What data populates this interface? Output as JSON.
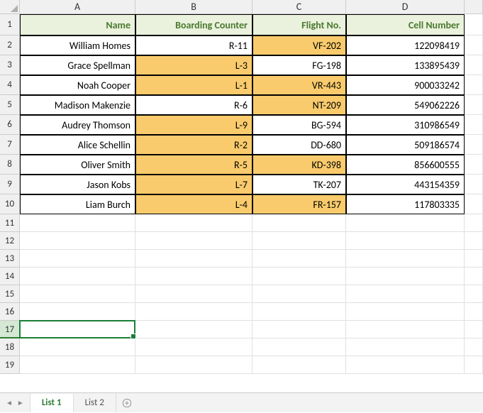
{
  "columns": [
    "A",
    "B",
    "C",
    "D",
    ""
  ],
  "row_numbers": [
    1,
    2,
    3,
    4,
    5,
    6,
    7,
    8,
    9,
    10,
    11,
    12,
    13,
    14,
    15,
    16,
    17,
    18,
    19
  ],
  "header": {
    "A": "Name",
    "B": "Boarding Counter",
    "C": "Flight No.",
    "D": "Cell Number"
  },
  "rows": [
    {
      "A": "William Homes",
      "B": "R-11",
      "C": "VF-202",
      "D": "122098419",
      "hl": {
        "B": false,
        "C": true
      }
    },
    {
      "A": "Grace Spellman",
      "B": "L-3",
      "C": "FG-198",
      "D": "133895439",
      "hl": {
        "B": true,
        "C": false
      }
    },
    {
      "A": "Noah Cooper",
      "B": "L-1",
      "C": "VR-443",
      "D": "900033242",
      "hl": {
        "B": true,
        "C": true
      }
    },
    {
      "A": "Madison Makenzie",
      "B": "R-6",
      "C": "NT-209",
      "D": "549062226",
      "hl": {
        "B": false,
        "C": true
      }
    },
    {
      "A": "Audrey Thomson",
      "B": "L-9",
      "C": "BG-594",
      "D": "310986549",
      "hl": {
        "B": true,
        "C": false
      }
    },
    {
      "A": "Alice Schellin",
      "B": "R-2",
      "C": "DD-680",
      "D": "509186574",
      "hl": {
        "B": true,
        "C": false
      }
    },
    {
      "A": "Oliver Smith",
      "B": "R-5",
      "C": "KD-398",
      "D": "856600555",
      "hl": {
        "B": true,
        "C": true
      }
    },
    {
      "A": "Jason Kobs",
      "B": "L-7",
      "C": "TK-207",
      "D": "443154359",
      "hl": {
        "B": true,
        "C": false
      }
    },
    {
      "A": "Liam Burch",
      "B": "L-4",
      "C": "FR-157",
      "D": "117803335",
      "hl": {
        "B": true,
        "C": true
      }
    }
  ],
  "active_cell_row": 17,
  "tabs": {
    "items": [
      "List 1",
      "List 2"
    ],
    "active": 0
  },
  "chart_data": {
    "type": "table",
    "columns": [
      "Name",
      "Boarding Counter",
      "Flight No.",
      "Cell Number"
    ],
    "rows": [
      [
        "William Homes",
        "R-11",
        "VF-202",
        122098419
      ],
      [
        "Grace Spellman",
        "L-3",
        "FG-198",
        133895439
      ],
      [
        "Noah Cooper",
        "L-1",
        "VR-443",
        900033242
      ],
      [
        "Madison Makenzie",
        "R-6",
        "NT-209",
        549062226
      ],
      [
        "Audrey Thomson",
        "L-9",
        "BG-594",
        310986549
      ],
      [
        "Alice Schellin",
        "R-2",
        "DD-680",
        509186574
      ],
      [
        "Oliver Smith",
        "R-5",
        "KD-398",
        856600555
      ],
      [
        "Jason Kobs",
        "L-7",
        "TK-207",
        443154359
      ],
      [
        "Liam Burch",
        "L-4",
        "FR-157",
        117803335
      ]
    ]
  }
}
